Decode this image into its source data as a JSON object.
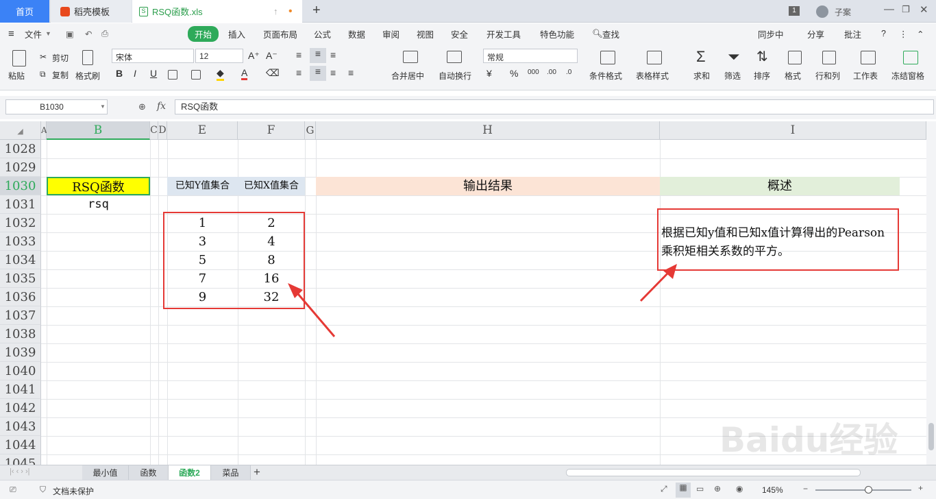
{
  "tabs": {
    "home": "首页",
    "template": "稻壳模板",
    "file": "RSQ函数.xls",
    "user": "子案",
    "badge": "1"
  },
  "menu": [
    "文件",
    "开始",
    "插入",
    "页面布局",
    "公式",
    "数据",
    "审阅",
    "视图",
    "安全",
    "开发工具",
    "特色功能",
    "查找"
  ],
  "menu_right": {
    "sync": "同步中",
    "share": "分享",
    "comment": "批注"
  },
  "ribbon": {
    "paste": "粘贴",
    "cut": "剪切",
    "copy": "复制",
    "format_painter": "格式刷",
    "font": "宋体",
    "size": "12",
    "merge": "合并居中",
    "wrap": "自动换行",
    "numfmt": "常规",
    "cond_format": "条件格式",
    "table_style": "表格样式",
    "sum": "求和",
    "filter": "筛选",
    "sort": "排序",
    "format": "格式",
    "rowcol": "行和列",
    "sheet": "工作表",
    "freeze": "冻结窗格"
  },
  "formula_bar": {
    "cell_ref": "B1030",
    "content": "RSQ函数"
  },
  "columns": [
    "A",
    "B",
    "C",
    "D",
    "E",
    "F",
    "G",
    "H",
    "I"
  ],
  "rows": [
    "1028",
    "1029",
    "1030",
    "1031",
    "1032",
    "1033",
    "1034",
    "1035",
    "1036",
    "1037",
    "1038",
    "1039",
    "1040",
    "1041",
    "1042",
    "1043",
    "1044",
    "1045"
  ],
  "cells": {
    "title": "RSQ函数",
    "func": "rsq",
    "y_header": "已知Y值集合",
    "x_header": "已知X值集合",
    "out_header": "输出结果",
    "desc_header": "概述",
    "y": [
      "1",
      "3",
      "5",
      "7",
      "9"
    ],
    "x": [
      "2",
      "4",
      "8",
      "16",
      "32"
    ],
    "description": "根据已知y值和已知x值计算得出的Pearson乘积矩相关系数的平方。"
  },
  "sheets": [
    "最小值",
    "函数",
    "函数2",
    "菜品"
  ],
  "status": {
    "protect": "文档未保护",
    "zoom": "145%"
  },
  "watermark": "Baidu经验 jingyan.baidu.com",
  "colors": {
    "accent": "#2eaa5a",
    "title_fill": "#ffff00",
    "red": "#e53935",
    "out_fill": "#fce4d6",
    "desc_fill": "#e2efda",
    "hdr_fill": "#dde6f0"
  }
}
